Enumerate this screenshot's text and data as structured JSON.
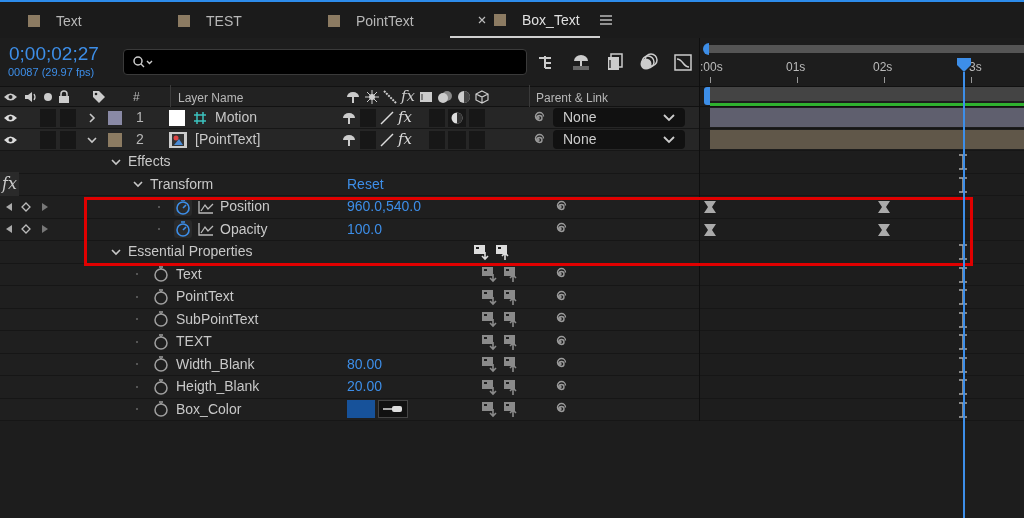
{
  "tabs": [
    {
      "label": "Text",
      "selected": false
    },
    {
      "label": "TEST",
      "selected": false
    },
    {
      "label": "PointText",
      "selected": false
    },
    {
      "label": "Box_Text",
      "selected": true
    }
  ],
  "timecode": "0;00;02;27",
  "frame_info": "00087 (29.97 fps)",
  "columns": {
    "number": "#",
    "name": "Layer Name",
    "effect_switch": "fx",
    "parent": "Parent & Link"
  },
  "layers": [
    {
      "number": "1",
      "name": "Motion",
      "kind": "solid",
      "color": "#8a8aa6",
      "expanded": false,
      "solo": false,
      "locked": false,
      "collapse": false,
      "effects_switch": "fx",
      "effects_on": true,
      "frame_blend": false,
      "adjustment": true,
      "three_d": false,
      "parent": "None"
    },
    {
      "number": "2",
      "name": "[PointText]",
      "kind": "comp",
      "color": "#8c7b62",
      "expanded": true,
      "solo": false,
      "locked": false,
      "collapse": false,
      "effects_switch": "fx",
      "effects_on": true,
      "frame_blend": false,
      "adjustment": false,
      "three_d": false,
      "parent": "None"
    }
  ],
  "properties": [
    {
      "kind": "group",
      "name": "Effects",
      "expanded": true,
      "children": [
        {
          "kind": "effect",
          "name": "Transform",
          "expanded": true,
          "fx_badge": "fx",
          "action": "Reset",
          "children": [
            {
              "kind": "property",
              "name": "Position",
              "animated": true,
              "value": "960.0,540.0",
              "keyframes": [
                {
                  "level": 0
                },
                {
                  "level": 0.554
                }
              ]
            },
            {
              "kind": "property",
              "name": "Opacity",
              "animated": true,
              "value": "100.0",
              "keyframes": [
                {
                  "level": 0
                },
                {
                  "level": 0.554
                }
              ]
            }
          ]
        }
      ]
    },
    {
      "kind": "essential",
      "name": "Essential Properties",
      "expanded": true,
      "children": [
        {
          "kind": "property",
          "name": "Text",
          "animated": false
        },
        {
          "kind": "property",
          "name": "PointText",
          "animated": false
        },
        {
          "kind": "property",
          "name": "SubPointText",
          "animated": false
        },
        {
          "kind": "property",
          "name": "TEXT",
          "animated": false
        },
        {
          "kind": "property",
          "name": "Width_Blank",
          "animated": false,
          "value": "80.00"
        },
        {
          "kind": "property",
          "name": "Heigth_Blank",
          "animated": false,
          "value": "20.00"
        },
        {
          "kind": "property",
          "name": "Box_Color",
          "animated": false,
          "color": "#17529a"
        }
      ]
    }
  ],
  "ruler": [
    ":00s",
    "01s",
    "02s",
    "3s"
  ],
  "playhead": {
    "level": 0.806
  }
}
